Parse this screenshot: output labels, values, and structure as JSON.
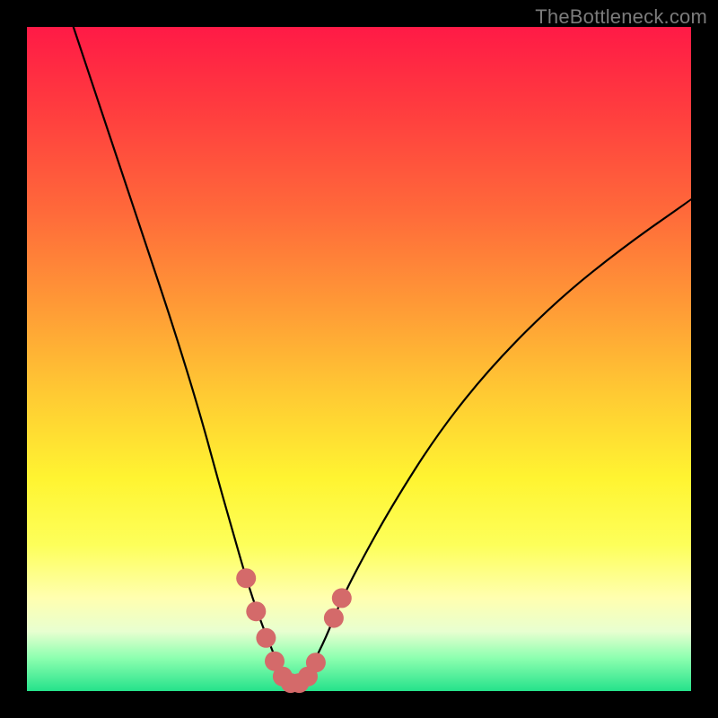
{
  "watermark": "TheBottleneck.com",
  "chart_data": {
    "type": "line",
    "title": "",
    "xlabel": "",
    "ylabel": "",
    "xlim": [
      0,
      100
    ],
    "ylim": [
      0,
      100
    ],
    "series": [
      {
        "name": "bottleneck-curve",
        "x": [
          7,
          10,
          14,
          18,
          22,
          26,
          29,
          31,
          33,
          35,
          37,
          38,
          39,
          40,
          41,
          42,
          43,
          45,
          47,
          50,
          55,
          62,
          70,
          80,
          90,
          100
        ],
        "y": [
          100,
          91,
          79,
          67,
          55,
          42,
          31,
          24,
          17,
          11,
          6,
          3.5,
          2,
          1.2,
          1.2,
          2,
          4,
          8,
          13,
          19,
          28,
          39,
          49,
          59,
          67,
          74
        ]
      }
    ],
    "markers": {
      "name": "highlight-dots",
      "color": "#d46a6a",
      "points": [
        {
          "x": 33.0,
          "y": 17
        },
        {
          "x": 34.5,
          "y": 12
        },
        {
          "x": 36.0,
          "y": 8
        },
        {
          "x": 37.3,
          "y": 4.5
        },
        {
          "x": 38.5,
          "y": 2.2
        },
        {
          "x": 39.7,
          "y": 1.2
        },
        {
          "x": 41.0,
          "y": 1.2
        },
        {
          "x": 42.3,
          "y": 2.2
        },
        {
          "x": 43.5,
          "y": 4.3
        },
        {
          "x": 46.2,
          "y": 11
        },
        {
          "x": 47.4,
          "y": 14
        }
      ]
    }
  }
}
